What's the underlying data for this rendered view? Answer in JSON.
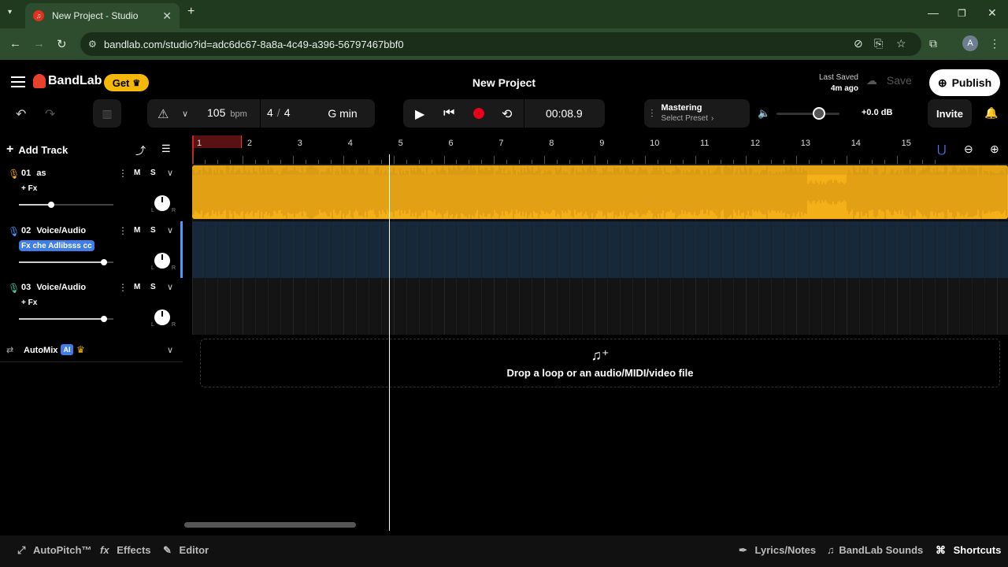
{
  "browser": {
    "tab_title": "New Project - Studio",
    "url": "bandlab.com/studio?id=adc6dc67-8a8a-4c49-a396-56797467bbf0",
    "profile_initial": "A"
  },
  "header": {
    "brand": "BandLab",
    "get_label": "Get",
    "project_title": "New Project",
    "last_saved_label": "Last Saved",
    "last_saved_time": "4m ago",
    "save_label": "Save",
    "publish_label": "Publish"
  },
  "toolbar": {
    "tempo": "105",
    "tempo_unit": "bpm",
    "time_sig_num": "4",
    "time_sig_sep": "/",
    "time_sig_den": "4",
    "key": "G min",
    "time_display": "00:08.9",
    "mastering_title": "Mastering",
    "mastering_preset": "Select Preset",
    "volume_db": "+0.0 dB",
    "invite_label": "Invite"
  },
  "tracks_panel": {
    "add_track_label": "Add Track",
    "automix_label": "AutoMix",
    "ai_badge": "AI"
  },
  "tracks": [
    {
      "number": "01",
      "name": "as",
      "fx": "+ Fx",
      "fx_active": false,
      "mute": "M",
      "solo": "S",
      "color": "#f5b019",
      "volume": 0.34
    },
    {
      "number": "02",
      "name": "Voice/Audio",
      "fx": "Fx che Adlibsss cc",
      "fx_active": true,
      "mute": "M",
      "solo": "S",
      "color": "#4a9bff",
      "volume": 0.9
    },
    {
      "number": "03",
      "name": "Voice/Audio",
      "fx": "+ Fx",
      "fx_active": false,
      "mute": "M",
      "solo": "S",
      "color": "#4bd1a0",
      "volume": 0.9
    }
  ],
  "timeline": {
    "bars": [
      "1",
      "2",
      "3",
      "4",
      "5",
      "6",
      "7",
      "8",
      "9",
      "10",
      "11",
      "12",
      "13",
      "14",
      "15"
    ],
    "playhead_position_bar": 4.9
  },
  "drop_zone": {
    "text": "Drop a loop or an audio/MIDI/video file"
  },
  "bottom_bar": {
    "autopitch": "AutoPitch™",
    "effects": "Effects",
    "editor": "Editor",
    "lyrics": "Lyrics/Notes",
    "sounds": "BandLab Sounds",
    "shortcuts": "Shortcuts"
  },
  "colors": {
    "accent": "#f5b70a",
    "record": "#e3001b",
    "waveform": "#f5b019",
    "lane_selected": "#16283a"
  }
}
